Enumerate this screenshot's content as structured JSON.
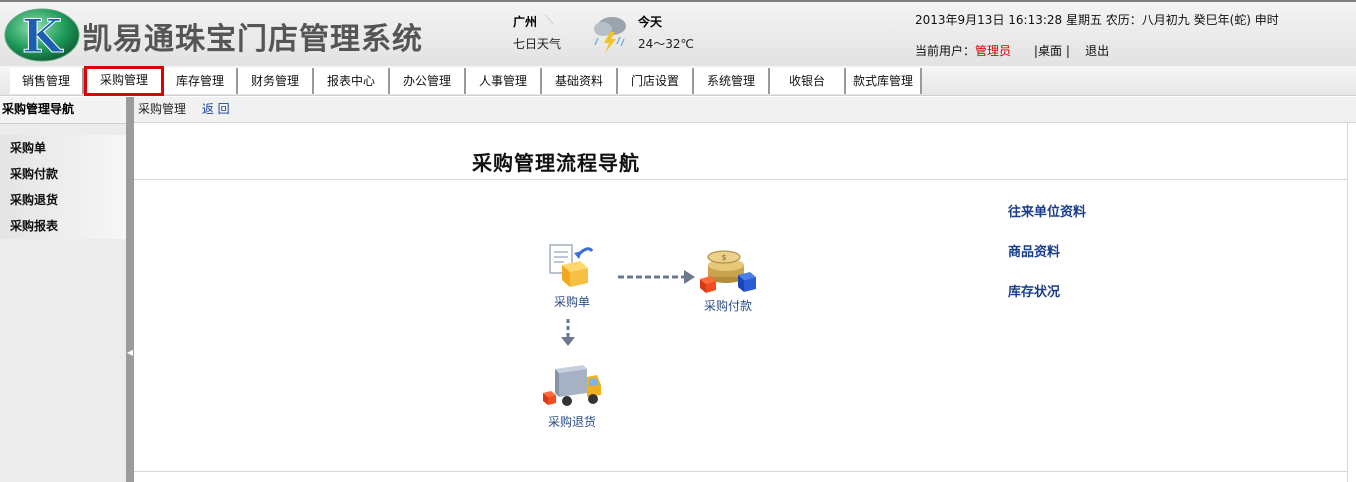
{
  "header": {
    "title": "凯易通珠宝门店管理系统",
    "city": "广州",
    "weather_link": "七日天气",
    "today_label": "今天",
    "temperature": "24～32℃",
    "datetime": "2013年9月13日  16:13:28 星期五  农历：八月初九  癸巳年(蛇) 申时",
    "current_user_label": "当前用户：",
    "current_user": "管理员",
    "desktop_link": "桌面",
    "logout_link": "退出",
    "logo_letter": "K"
  },
  "nav": {
    "tabs": [
      "销售管理",
      "采购管理",
      "库存管理",
      "财务管理",
      "报表中心",
      "办公管理",
      "人事管理",
      "基础资料",
      "门店设置",
      "系统管理",
      "收银台",
      "款式库管理"
    ],
    "active": "采购管理"
  },
  "sidebar": {
    "title": "采购管理导航",
    "items": [
      "采购单",
      "采购付款",
      "采购退货",
      "采购报表"
    ]
  },
  "breadcrumb": {
    "current": "采购管理",
    "back": "返 回"
  },
  "main": {
    "title": "采购管理流程导航",
    "flow": {
      "purchase_order": "采购单",
      "purchase_payment": "采购付款",
      "purchase_return": "采购退货"
    },
    "links": [
      "往来单位资料",
      "商品资料",
      "库存状况"
    ]
  },
  "colors": {
    "active_tab_border": "#e10000",
    "link_blue": "#1a3e8c",
    "user_red": "#d40000",
    "splitter": "#9c9c9c"
  }
}
